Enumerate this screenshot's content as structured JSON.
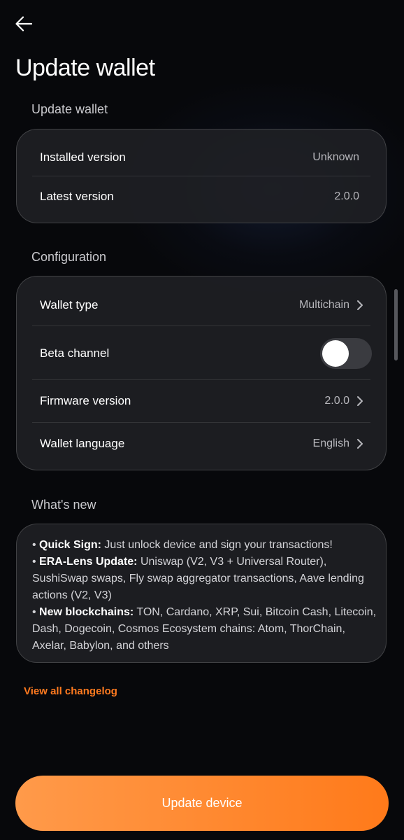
{
  "header": {
    "back_icon": "arrow-left-icon",
    "title": "Update wallet"
  },
  "update_section": {
    "label": "Update wallet",
    "rows": [
      {
        "label": "Installed version",
        "value": "Unknown"
      },
      {
        "label": "Latest version",
        "value": "2.0.0"
      }
    ]
  },
  "configuration": {
    "label": "Configuration",
    "wallet_type": {
      "label": "Wallet type",
      "value": "Multichain"
    },
    "beta_channel": {
      "label": "Beta channel",
      "enabled": false
    },
    "firmware_version": {
      "label": "Firmware version",
      "value": "2.0.0"
    },
    "wallet_language": {
      "label": "Wallet language",
      "value": "English"
    }
  },
  "whats_new": {
    "label": "What's new",
    "items": [
      {
        "title": "Quick Sign:",
        "lines": [
          "Just unlock device and sign your transactions!"
        ]
      },
      {
        "title": "ERA-Lens Update:",
        "lines": [
          "Uniswap (V2, V3 + Universal Router),",
          "SushiSwap swaps, Fly swap aggregator transactions, Aave lending",
          "actions (V2, V3)"
        ]
      },
      {
        "title": "New blockchains:",
        "lines": [
          "TON, Cardano, XRP, Sui, Bitcoin Cash, Litecoin,",
          "Dash, Dogecoin, Cosmos Ecosystem chains: Atom, ThorChain,",
          "Axelar, Babylon, and others"
        ]
      }
    ]
  },
  "changelog_link": "View all changelog",
  "primary_button": "Update device",
  "colors": {
    "accent": "#ff7a1f",
    "background": "#07080b",
    "card": "#1e1f24"
  }
}
